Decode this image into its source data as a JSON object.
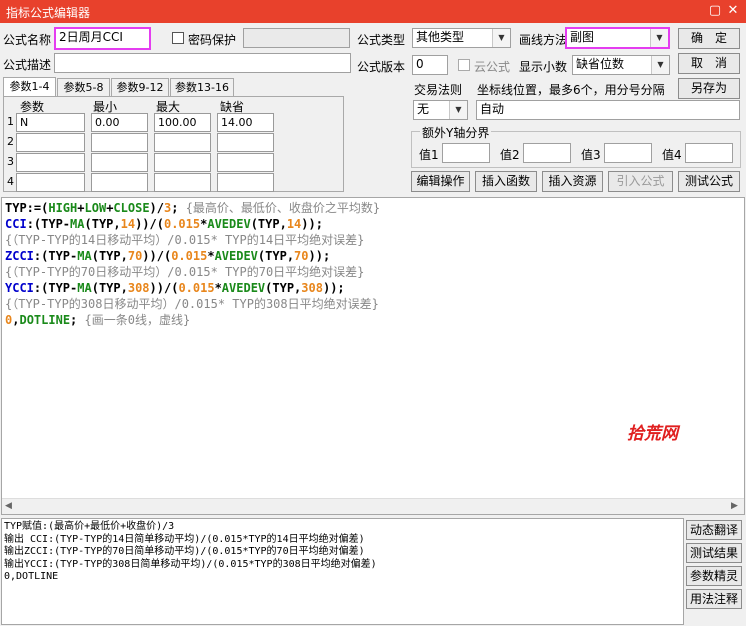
{
  "window": {
    "title": "指标公式编辑器"
  },
  "form": {
    "name_label": "公式名称",
    "name_value": "2日周月CCI",
    "password_label": "密码保护",
    "desc_label": "公式描述",
    "type_label": "公式类型",
    "type_value": "其他类型",
    "draw_label": "画线方法",
    "draw_value": "副图",
    "version_label": "公式版本",
    "version_value": "0",
    "cloud_label": "云公式",
    "decimals_label": "显示小数",
    "decimals_value": "缺省位数",
    "trade_label": "交易法则",
    "trade_value": "无",
    "coord_label": "坐标线位置，最多6个，用分号分隔",
    "coord_value": "自动",
    "yaxis_label": "额外Y轴分界",
    "val1": "值1",
    "val2": "值2",
    "val3": "值3",
    "val4": "值4"
  },
  "buttons": {
    "ok": "确　定",
    "cancel": "取　消",
    "save_as": "另存为",
    "edit": "编辑操作",
    "insert_func": "插入函数",
    "insert_res": "插入资源",
    "import": "引入公式",
    "test": "测试公式"
  },
  "tabs": [
    "参数1-4",
    "参数5-8",
    "参数9-12",
    "参数13-16"
  ],
  "params": {
    "headers": [
      "参数",
      "最小",
      "最大",
      "缺省"
    ],
    "rows": [
      {
        "idx": "1",
        "name": "N",
        "min": "0.00",
        "max": "100.00",
        "def": "14.00"
      },
      {
        "idx": "2",
        "name": "",
        "min": "",
        "max": "",
        "def": ""
      },
      {
        "idx": "3",
        "name": "",
        "min": "",
        "max": "",
        "def": ""
      },
      {
        "idx": "4",
        "name": "",
        "min": "",
        "max": "",
        "def": ""
      }
    ]
  },
  "watermark": "拾荒网",
  "output": {
    "lines": [
      "TYP赋值:(最高价+最低价+收盘价)/3",
      "输出 CCI:(TYP-TYP的14日简单移动平均)/(0.015*TYP的14日平均绝对偏差)",
      "输出ZCCI:(TYP-TYP的70日简单移动平均)/(0.015*TYP的70日平均绝对偏差)",
      "输出YCCI:(TYP-TYP的308日简单移动平均)/(0.015*TYP的308日平均绝对偏差)",
      "0,DOTLINE"
    ]
  },
  "side_buttons": [
    "动态翻译",
    "测试结果",
    "参数精灵",
    "用法注释"
  ],
  "colors": {
    "title_bar": "#e8412c",
    "highlight": "#e43df0",
    "number": "#e8861c",
    "function": "#1a8a1a",
    "output_name": "#0000cc",
    "comment": "#888888",
    "watermark": "#e02020"
  }
}
